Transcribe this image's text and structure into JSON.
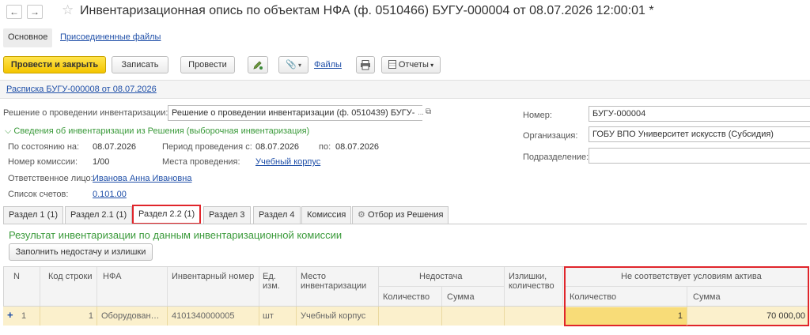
{
  "window": {
    "title": "Инвентаризационная опись по объектам НФА (ф. 0510466) БУГУ-000004 от 08.07.2026 12:00:01 *",
    "back": "←",
    "forward": "→",
    "star": "☆"
  },
  "top_tabs": {
    "main": "Основное",
    "files": "Присоединенные файлы"
  },
  "toolbar": {
    "post_close": "Провести и закрыть",
    "save": "Записать",
    "post": "Провести",
    "files_link": "Файлы",
    "reports": "Отчеты"
  },
  "receipt_link": "Расписка БУГУ-000008 от 08.07.2026",
  "decision": {
    "label": "Решение о проведении инвентаризации:",
    "value": "Решение о проведении инвентаризации (ф. 0510439) БУГУ-(",
    "more": "..."
  },
  "right_fields": {
    "number_label": "Номер:",
    "number_value": "БУГУ-000004",
    "org_label": "Организация:",
    "org_value": "ГОБУ ВПО Университет искусств (Субсидия)",
    "dept_label": "Подразделение:",
    "dept_value": ""
  },
  "info": {
    "header": "Сведения об инвентаризации из Решения (выборочная инвентаризация)",
    "as_of_label": "По состоянию на:",
    "as_of_value": "08.07.2026",
    "period_label": "Период проведения с:",
    "period_from": "08.07.2026",
    "period_to_label": "по:",
    "period_to": "08.07.2026",
    "commission_label": "Номер комиссии:",
    "commission_value": "1/00",
    "places_label": "Места проведения:",
    "places_value": "Учебный корпус",
    "responsible_label": "Ответственное лицо:",
    "responsible_value": "Иванова Анна Ивановна",
    "accounts_label": "Список счетов:",
    "accounts_value": "0.101.00"
  },
  "section_tabs": [
    "Раздел 1 (1)",
    "Раздел 2.1 (1)",
    "Раздел 2.2 (1)",
    "Раздел 3",
    "Раздел 4",
    "Комиссия",
    "Отбор из Решения"
  ],
  "section": {
    "title": "Результат инвентаризации по данным инвентаризационной комиссии",
    "fill_button": "Заполнить недостачу и излишки"
  },
  "table": {
    "headers": {
      "n": "N",
      "line_code": "Код строки",
      "nfa": "НФА",
      "inv_number": "Инвентарный номер",
      "unit": "Ед. изм.",
      "place": "Место инвентаризации",
      "shortage": "Недостача",
      "shortage_qty": "Количество",
      "shortage_sum": "Сумма",
      "surplus": "Излишки, количество",
      "noncompliant": "Не соответствует условиям актива",
      "nc_qty": "Количество",
      "nc_sum": "Сумма"
    },
    "row": {
      "n": "1",
      "line_code": "1",
      "nfa": "Оборудован…",
      "inv_number": "4101340000005",
      "unit": "шт",
      "place": "Учебный корпус",
      "shortage_qty": "",
      "shortage_sum": "",
      "surplus": "",
      "nc_qty": "1",
      "nc_sum": "70 000,00"
    }
  },
  "colors": {
    "accent_yellow": "#f4c500",
    "highlight_red": "#e0252b",
    "row_selected": "#fbf0cc",
    "cell_active": "#f8dc78",
    "green_title": "#3a9a3a",
    "link": "#1f4fa8"
  }
}
